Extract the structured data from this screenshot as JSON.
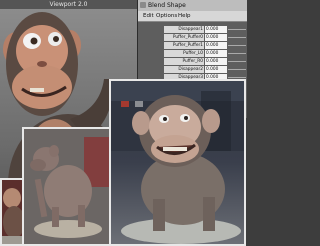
{
  "viewport": {
    "title": "Viewport 2.0"
  },
  "blend_shape": {
    "title": "Blend Shape",
    "menu": [
      "Edit",
      "Options",
      "Help"
    ],
    "rows": [
      {
        "label": "Disappear1",
        "value": "0.000"
      },
      {
        "label": "Puffer_Puffer0",
        "value": "0.000"
      },
      {
        "label": "Puffer_Puffer1",
        "value": "0.000"
      },
      {
        "label": "Puffer_L0",
        "value": "0.000"
      },
      {
        "label": "Puffer_R0",
        "value": "0.000"
      },
      {
        "label": "Disappear2",
        "value": "0.000"
      },
      {
        "label": "Disappear3",
        "value": "0.000"
      }
    ]
  },
  "colors": {
    "window_title_bg": "#bdbdbd",
    "menu_bg": "#d7d7d7",
    "panel_bg": "#5e5e5e",
    "chimp_skin": "#c48e74",
    "chimp_fur": "#54463f"
  }
}
